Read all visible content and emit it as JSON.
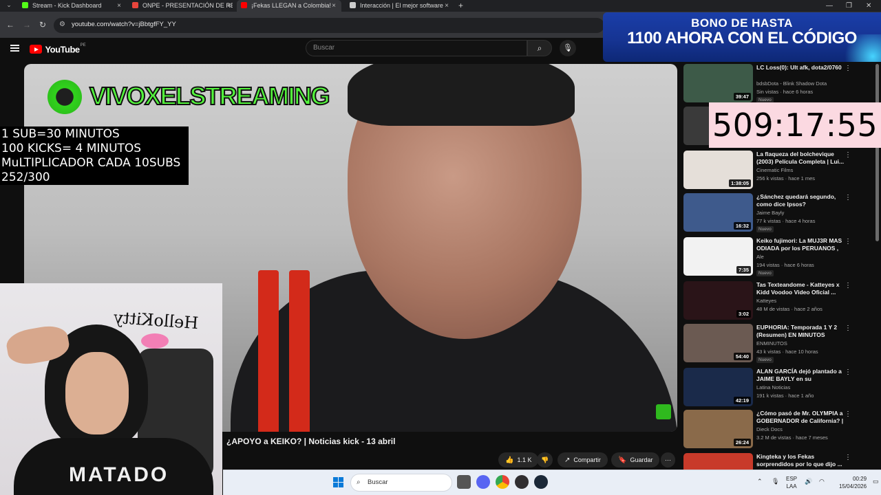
{
  "browser": {
    "tabs": [
      {
        "label": "Stream - Kick Dashboard",
        "color": "#53fc18"
      },
      {
        "label": "ONPE - PRESENTACIÓN DE RES",
        "color": "#e8453c"
      },
      {
        "label": "¡Fekas LLEGAN a Colombia!",
        "color": "#ff0000"
      },
      {
        "label": "Interacción | El mejor software",
        "color": "#cccccc"
      }
    ],
    "url": "youtube.com/watch?v=jBbtgfFY_YY"
  },
  "youtube": {
    "logo_text": "YouTube",
    "country_code": "PE",
    "search_placeholder": "Buscar"
  },
  "promo": {
    "line1": "BONO DE HASTA",
    "line2": "1100 AHORA CON EL CÓDIGO"
  },
  "video": {
    "channel_overlay": "VIVOXELSTREAMING",
    "title": "¿APOYO a KEIKO? | Noticias kick - 13 abril",
    "likes": "1.1 K",
    "share_label": "Compartir",
    "save_label": "Guardar"
  },
  "overlay_info": {
    "lines": [
      "1 SUB=30 MINUTOS",
      "100 KICKS= 4 MINUTOS",
      "MuLTIPLICADOR CADA 10SUBS",
      "252/300"
    ]
  },
  "timer": "509:17:55",
  "webcam": {
    "wall_text": "HelloKitty",
    "shirt_text": "MATADO"
  },
  "recommendations": [
    {
      "title": "LC Loss(0): Ult afk, dota2/0760",
      "channel": "bdsbDota - Blink Shadow Dota",
      "meta": "Sin vistas · hace 6 horas",
      "badge": "Nuevo",
      "duration": "39:47",
      "thumb": "#3d5a48"
    },
    {
      "title": "",
      "channel": "",
      "meta": "",
      "badge": "",
      "duration": "",
      "thumb": "#3a3a3a"
    },
    {
      "title": "La flaqueza del bolchevique (2003) Película Completa | Lui...",
      "channel": "Cinematic Films",
      "meta": "256 k vistas · hace 1 mes",
      "badge": "",
      "duration": "1:38:05",
      "thumb": "#e5dfd9"
    },
    {
      "title": "¿Sánchez quedará segundo, como dice Ipsos?",
      "channel": "Jaime Bayly",
      "meta": "77 k vistas · hace 4 horas",
      "badge": "Nuevo",
      "duration": "16:32",
      "thumb": "#3e5a8c"
    },
    {
      "title": "Keiko fujimori: La MUJ3R MAS ODIADA por los PERUANOS , ...",
      "channel": "Ale",
      "meta": "194 vistas · hace 6 horas",
      "badge": "Nuevo",
      "duration": "7:35",
      "thumb": "#f2f2f2"
    },
    {
      "title": "Tas Texteandome - Katteyes x Kidd Voodoo Video Oficial ...",
      "channel": "Katteyes",
      "meta": "48 M de vistas · hace 2 años",
      "badge": "",
      "duration": "3:02",
      "thumb": "#2a1418"
    },
    {
      "title": "EUPHORIA: Temporada 1 Y 2 (Resumen) EN MINUTOS",
      "channel": "ENMINUTOS",
      "meta": "43 k vistas · hace 10 horas",
      "badge": "Nuevo",
      "duration": "54:40",
      "thumb": "#6b5a52"
    },
    {
      "title": "ALAN GARCÍA dejó plantado a JAIME BAYLY en su programa:...",
      "channel": "Latina Noticias",
      "meta": "191 k vistas · hace 1 año",
      "badge": "",
      "duration": "42:19",
      "thumb": "#1a2a4a"
    },
    {
      "title": "¿Cómo pasó de Mr. OLYMPIA a GOBERNADOR de California? | ...",
      "channel": "Dieck Docs",
      "meta": "3.2 M de vistas · hace 7 meses",
      "badge": "",
      "duration": "26:24",
      "thumb": "#8a6a4a"
    },
    {
      "title": "Kingteka y los Fekas sorprendidos por lo que dijo ...",
      "channel": "",
      "meta": "",
      "badge": "",
      "duration": "",
      "thumb": "#c83a2a"
    }
  ],
  "taskbar": {
    "search_placeholder": "Buscar",
    "lang_line1": "ESP",
    "lang_line2": "LAA",
    "time": "00:29",
    "date": "15/04/2026"
  }
}
